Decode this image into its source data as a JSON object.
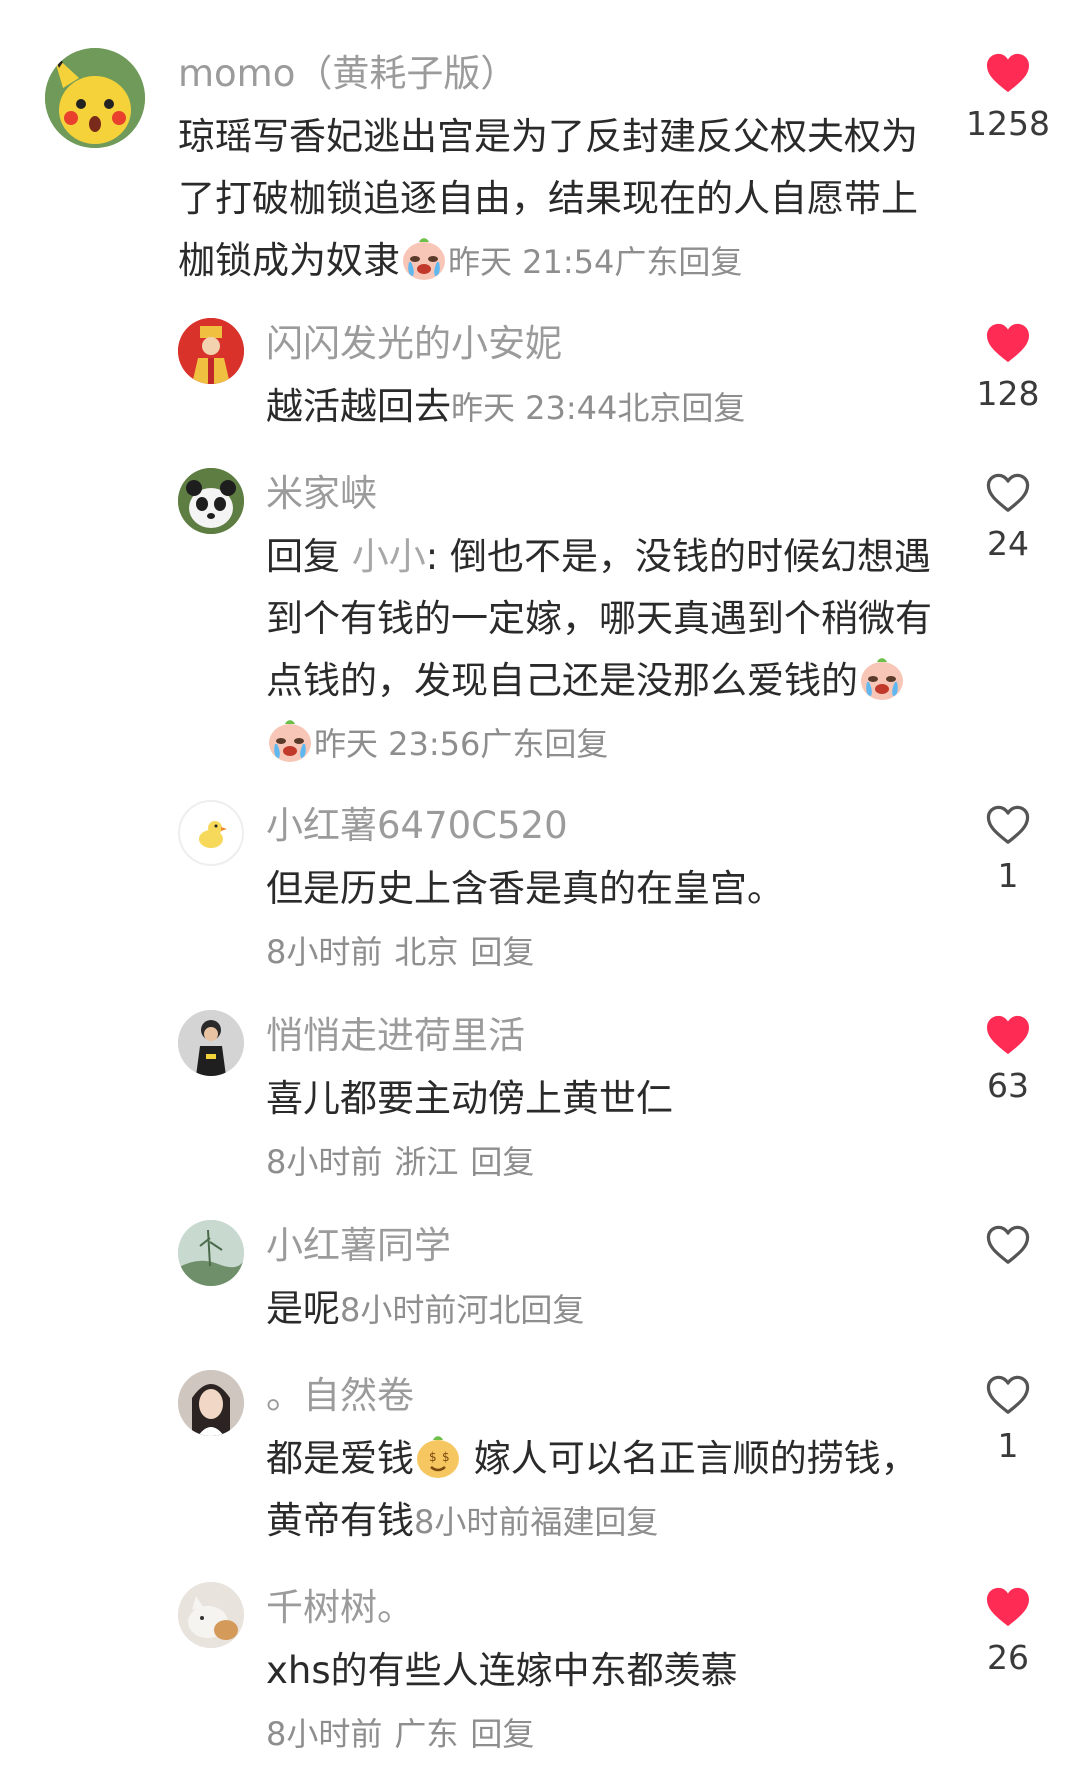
{
  "colors": {
    "heart_red": "#fe2c55",
    "heart_outline": "#555555",
    "name_gray": "#9b9b9b",
    "meta_gray": "#8e8e8e"
  },
  "comments": [
    {
      "name": "momo（黄耗子版）",
      "text": "琼瑶写香妃逃出宫是为了反封建反父权夫权为了打破枷锁追逐自由，结果现在的人自愿带上枷锁成为奴隶",
      "emojis": [
        "crying-emoji"
      ],
      "time": "昨天 21:54",
      "location": "广东",
      "reply": "回复",
      "likes": "1258",
      "liked": true,
      "avatar": "pikachu-avatar"
    },
    {
      "name": "闪闪发光的小安妮",
      "text": "越活越回去",
      "time": "昨天 23:44",
      "location": "北京",
      "reply": "回复",
      "likes": "128",
      "liked": true,
      "avatar": "red-figure-avatar"
    },
    {
      "name": "米家峡",
      "reply_prefix": "回复",
      "reply_to": "小小",
      "text": ": 倒也不是，没钱的时候幻想遇到个有钱的一定嫁，哪天真遇到个稍微有点钱的，发现自己还是没那么爱钱的",
      "emojis": [
        "crying-emoji",
        "crying-emoji"
      ],
      "time": "昨天 23:56",
      "location": "广东",
      "reply": "回复",
      "likes": "24",
      "liked": false,
      "avatar": "panda-avatar"
    },
    {
      "name": "小红薯6470C520",
      "text": "但是历史上含香是真的在皇宫。",
      "time": "8小时前",
      "location": "北京",
      "reply": "回复",
      "likes": "1",
      "liked": false,
      "avatar": "duck-avatar"
    },
    {
      "name": "悄悄走进荷里活",
      "text": "喜儿都要主动傍上黄世仁",
      "time": "8小时前",
      "location": "浙江",
      "reply": "回复",
      "likes": "63",
      "liked": true,
      "avatar": "child-avatar"
    },
    {
      "name": "小红薯同学",
      "text": "是呢",
      "time": "8小时前",
      "location": "河北",
      "reply": "回复",
      "likes": "",
      "liked": false,
      "avatar": "nature-avatar"
    },
    {
      "name": "。自然卷",
      "text_before": "都是爱钱",
      "emojis": [
        "money-emoji"
      ],
      "text": "嫁人可以名正言顺的捞钱，黄帝有钱",
      "time": "8小时前",
      "location": "福建",
      "reply": "回复",
      "likes": "1",
      "liked": false,
      "avatar": "girl-avatar"
    },
    {
      "name": "千树树。",
      "text": "xhs的有些人连嫁中东都羡慕",
      "time": "8小时前",
      "location": "广东",
      "reply": "回复",
      "likes": "26",
      "liked": true,
      "avatar": "cat-avatar"
    }
  ]
}
